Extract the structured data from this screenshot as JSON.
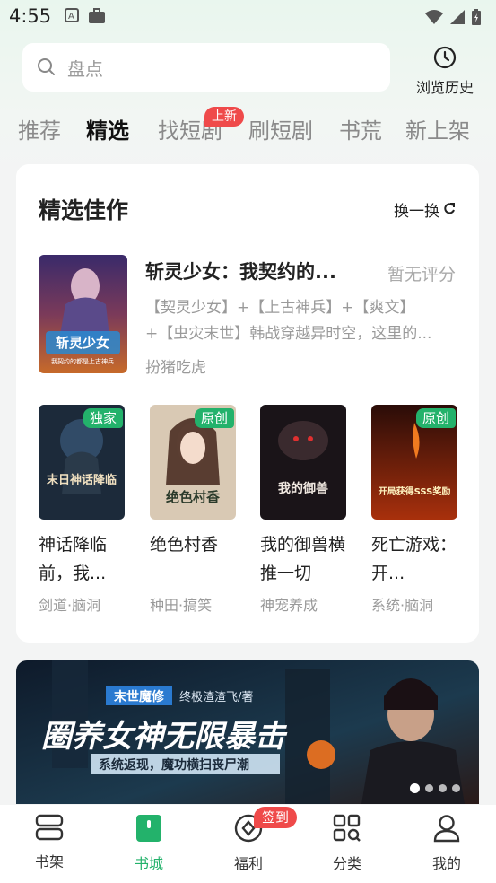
{
  "status": {
    "time": "4:55"
  },
  "search": {
    "placeholder": "盘点"
  },
  "history": {
    "label": "浏览历史"
  },
  "tabs": [
    {
      "label": "推荐"
    },
    {
      "label": "精选"
    },
    {
      "label": "找短剧"
    },
    {
      "label": "刷短剧"
    },
    {
      "label": "书荒"
    },
    {
      "label": "新上架"
    }
  ],
  "tab_badge": "上新",
  "section": {
    "title": "精选佳作",
    "refresh": "换一换"
  },
  "featured": {
    "title": "斩灵少女：我契约的...",
    "rating": "暂无评分",
    "desc_line1": "【契灵少女】+【上古神兵】+【爽文】",
    "desc_line2": "+【虫灾末世】韩战穿越异时空，这里的...",
    "author": "扮猪吃虎",
    "cover_text": "斩灵少女",
    "cover_sub": "我契约的都是上古神兵"
  },
  "books": [
    {
      "title": "神话降临前，我...",
      "tags": "剑道·脑洞",
      "badge": "独家",
      "cover_text": "末日神话降临"
    },
    {
      "title": "绝色村香",
      "tags": "种田·搞笑",
      "badge": "原创",
      "cover_text": "绝色村香"
    },
    {
      "title": "我的御兽横推一切",
      "tags": "神宠养成",
      "badge": "",
      "cover_text": "我的御兽"
    },
    {
      "title": "死亡游戏：开...",
      "tags": "系统·脑洞",
      "badge": "原创",
      "cover_text": "开局获得SSS奖励"
    }
  ],
  "banner": {
    "tag": "末世魔修",
    "author": "终极渣渣飞/著",
    "headline": "圈养女神无限暴击",
    "subline": "系统返现，魔功横扫丧尸潮"
  },
  "nav": [
    {
      "label": "书架"
    },
    {
      "label": "书城"
    },
    {
      "label": "福利"
    },
    {
      "label": "分类"
    },
    {
      "label": "我的"
    }
  ],
  "nav_badge": "签到",
  "colors": {
    "accent": "#23b26b",
    "badge_red": "#ef4a4a"
  }
}
